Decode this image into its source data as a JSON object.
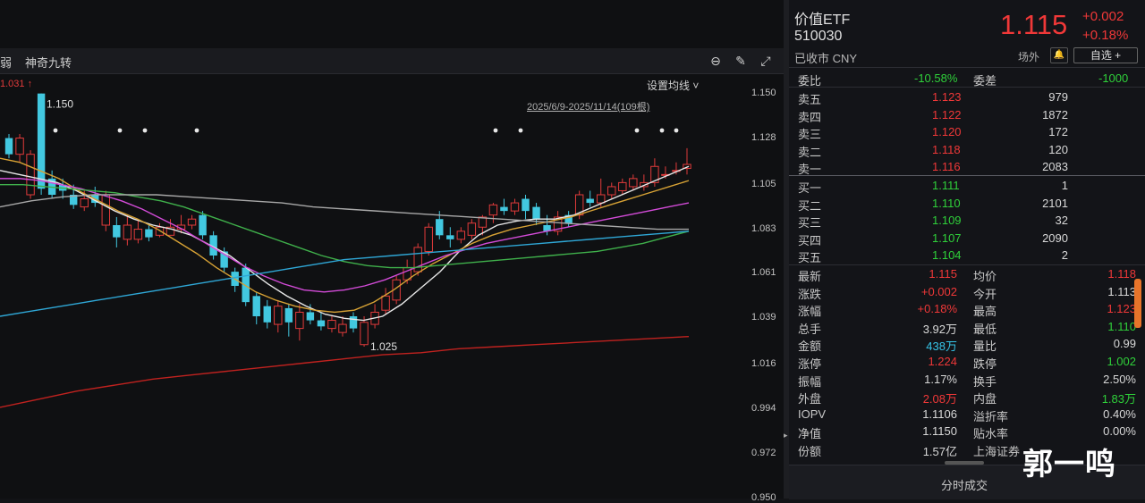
{
  "toolbar": {
    "left_fragment": "弱",
    "indicator": "神奇九转"
  },
  "chart": {
    "ma_note": "1.031 ↑",
    "set_ma_label": "设置均线 ˅",
    "range_label": "2025/6/9-2025/11/14(109根)",
    "high_label": "1.150",
    "low_label": "1.025",
    "yaxis": [
      "1.150",
      "1.128",
      "1.105",
      "1.083",
      "1.061",
      "1.039",
      "1.016",
      "0.994",
      "0.972",
      "0.950"
    ]
  },
  "chart_data": {
    "type": "candlestick",
    "ylim": [
      0.95,
      1.16
    ],
    "candles": [
      {
        "o": 1.128,
        "c": 1.12,
        "h": 1.13,
        "l": 1.118
      },
      {
        "o": 1.12,
        "c": 1.128,
        "h": 1.13,
        "l": 1.116
      },
      {
        "o": 1.1,
        "c": 1.12,
        "h": 1.122,
        "l": 1.098
      },
      {
        "o": 1.15,
        "c": 1.103,
        "h": 1.15,
        "l": 1.1
      },
      {
        "o": 1.108,
        "c": 1.1,
        "h": 1.112,
        "l": 1.098
      },
      {
        "o": 1.105,
        "c": 1.102,
        "h": 1.108,
        "l": 1.098
      },
      {
        "o": 1.1,
        "c": 1.095,
        "h": 1.105,
        "l": 1.093
      },
      {
        "o": 1.094,
        "c": 1.098,
        "h": 1.102,
        "l": 1.092
      },
      {
        "o": 1.1,
        "c": 1.096,
        "h": 1.104,
        "l": 1.094
      },
      {
        "o": 1.085,
        "c": 1.1,
        "h": 1.102,
        "l": 1.082
      },
      {
        "o": 1.085,
        "c": 1.079,
        "h": 1.089,
        "l": 1.074
      },
      {
        "o": 1.078,
        "c": 1.085,
        "h": 1.09,
        "l": 1.075
      },
      {
        "o": 1.078,
        "c": 1.083,
        "h": 1.088,
        "l": 1.076
      },
      {
        "o": 1.083,
        "c": 1.079,
        "h": 1.085,
        "l": 1.077
      },
      {
        "o": 1.08,
        "c": 1.084,
        "h": 1.086,
        "l": 1.079
      },
      {
        "o": 1.08,
        "c": 1.084,
        "h": 1.088,
        "l": 1.08
      },
      {
        "o": 1.083,
        "c": 1.085,
        "h": 1.09,
        "l": 1.081
      },
      {
        "o": 1.085,
        "c": 1.088,
        "h": 1.09,
        "l": 1.083
      },
      {
        "o": 1.09,
        "c": 1.08,
        "h": 1.092,
        "l": 1.078
      },
      {
        "o": 1.08,
        "c": 1.07,
        "h": 1.082,
        "l": 1.068
      },
      {
        "o": 1.072,
        "c": 1.064,
        "h": 1.074,
        "l": 1.062
      },
      {
        "o": 1.062,
        "c": 1.055,
        "h": 1.064,
        "l": 1.052
      },
      {
        "o": 1.064,
        "c": 1.047,
        "h": 1.066,
        "l": 1.045
      },
      {
        "o": 1.05,
        "c": 1.04,
        "h": 1.052,
        "l": 1.036
      },
      {
        "o": 1.045,
        "c": 1.037,
        "h": 1.048,
        "l": 1.034
      },
      {
        "o": 1.036,
        "c": 1.045,
        "h": 1.048,
        "l": 1.032
      },
      {
        "o": 1.044,
        "c": 1.037,
        "h": 1.046,
        "l": 1.03
      },
      {
        "o": 1.034,
        "c": 1.042,
        "h": 1.046,
        "l": 1.028
      },
      {
        "o": 1.042,
        "c": 1.038,
        "h": 1.046,
        "l": 1.036
      },
      {
        "o": 1.038,
        "c": 1.035,
        "h": 1.042,
        "l": 1.033
      },
      {
        "o": 1.034,
        "c": 1.038,
        "h": 1.04,
        "l": 1.032
      },
      {
        "o": 1.032,
        "c": 1.036,
        "h": 1.04,
        "l": 1.03
      },
      {
        "o": 1.04,
        "c": 1.034,
        "h": 1.042,
        "l": 1.032
      },
      {
        "o": 1.026,
        "c": 1.037,
        "h": 1.04,
        "l": 1.025
      },
      {
        "o": 1.036,
        "c": 1.042,
        "h": 1.046,
        "l": 1.034
      },
      {
        "o": 1.043,
        "c": 1.05,
        "h": 1.054,
        "l": 1.041
      },
      {
        "o": 1.048,
        "c": 1.058,
        "h": 1.06,
        "l": 1.046
      },
      {
        "o": 1.058,
        "c": 1.064,
        "h": 1.068,
        "l": 1.056
      },
      {
        "o": 1.062,
        "c": 1.074,
        "h": 1.076,
        "l": 1.06
      },
      {
        "o": 1.072,
        "c": 1.084,
        "h": 1.086,
        "l": 1.07
      },
      {
        "o": 1.088,
        "c": 1.08,
        "h": 1.092,
        "l": 1.078
      },
      {
        "o": 1.08,
        "c": 1.078,
        "h": 1.084,
        "l": 1.074
      },
      {
        "o": 1.078,
        "c": 1.082,
        "h": 1.084,
        "l": 1.076
      },
      {
        "o": 1.08,
        "c": 1.086,
        "h": 1.088,
        "l": 1.078
      },
      {
        "o": 1.084,
        "c": 1.089,
        "h": 1.09,
        "l": 1.08
      },
      {
        "o": 1.09,
        "c": 1.095,
        "h": 1.096,
        "l": 1.086
      },
      {
        "o": 1.094,
        "c": 1.092,
        "h": 1.098,
        "l": 1.09
      },
      {
        "o": 1.092,
        "c": 1.096,
        "h": 1.098,
        "l": 1.09
      },
      {
        "o": 1.098,
        "c": 1.092,
        "h": 1.1,
        "l": 1.088
      },
      {
        "o": 1.094,
        "c": 1.088,
        "h": 1.096,
        "l": 1.085
      },
      {
        "o": 1.085,
        "c": 1.082,
        "h": 1.09,
        "l": 1.08
      },
      {
        "o": 1.082,
        "c": 1.089,
        "h": 1.092,
        "l": 1.08
      },
      {
        "o": 1.09,
        "c": 1.086,
        "h": 1.092,
        "l": 1.084
      },
      {
        "o": 1.09,
        "c": 1.1,
        "h": 1.102,
        "l": 1.088
      },
      {
        "o": 1.098,
        "c": 1.096,
        "h": 1.102,
        "l": 1.094
      },
      {
        "o": 1.096,
        "c": 1.1,
        "h": 1.108,
        "l": 1.094
      },
      {
        "o": 1.1,
        "c": 1.104,
        "h": 1.106,
        "l": 1.098
      },
      {
        "o": 1.102,
        "c": 1.106,
        "h": 1.108,
        "l": 1.1
      },
      {
        "o": 1.104,
        "c": 1.108,
        "h": 1.11,
        "l": 1.102
      },
      {
        "o": 1.104,
        "c": 1.106,
        "h": 1.11,
        "l": 1.102
      },
      {
        "o": 1.106,
        "c": 1.114,
        "h": 1.118,
        "l": 1.104
      },
      {
        "o": 1.11,
        "c": 1.11,
        "h": 1.114,
        "l": 1.108
      },
      {
        "o": 1.112,
        "c": 1.112,
        "h": 1.116,
        "l": 1.11
      },
      {
        "o": 1.113,
        "c": 1.115,
        "h": 1.123,
        "l": 1.11
      }
    ],
    "ma_lines": [
      {
        "color": "#e8e8e8",
        "points": [
          1.112,
          1.11,
          1.108,
          1.106,
          1.102,
          1.097,
          1.092,
          1.088,
          1.085,
          1.083,
          1.08,
          1.075,
          1.07,
          1.063,
          1.056,
          1.05,
          1.045,
          1.041,
          1.039,
          1.038,
          1.04,
          1.046,
          1.054,
          1.062,
          1.072,
          1.08,
          1.085,
          1.087,
          1.088,
          1.088,
          1.09,
          1.094,
          1.098,
          1.102,
          1.106,
          1.11,
          1.114
        ]
      },
      {
        "color": "#d7a235",
        "points": [
          1.118,
          1.116,
          1.112,
          1.108,
          1.102,
          1.097,
          1.092,
          1.088,
          1.083,
          1.077,
          1.071,
          1.064,
          1.058,
          1.052,
          1.048,
          1.045,
          1.043,
          1.042,
          1.043,
          1.047,
          1.053,
          1.06,
          1.066,
          1.071,
          1.076,
          1.08,
          1.083,
          1.085,
          1.087,
          1.089,
          1.092,
          1.095,
          1.098,
          1.101,
          1.104,
          1.107
        ]
      },
      {
        "color": "#d34bd8",
        "points": [
          1.108,
          1.108,
          1.107,
          1.105,
          1.103,
          1.1,
          1.097,
          1.093,
          1.088,
          1.083,
          1.077,
          1.071,
          1.065,
          1.06,
          1.056,
          1.053,
          1.052,
          1.053,
          1.055,
          1.058,
          1.062,
          1.066,
          1.07,
          1.073,
          1.076,
          1.078,
          1.08,
          1.082,
          1.084,
          1.086,
          1.088,
          1.09,
          1.092,
          1.094,
          1.096
        ]
      },
      {
        "color": "#3fb04b",
        "points": [
          1.105,
          1.105,
          1.104,
          1.103,
          1.102,
          1.101,
          1.099,
          1.097,
          1.094,
          1.09,
          1.086,
          1.082,
          1.078,
          1.074,
          1.07,
          1.067,
          1.065,
          1.064,
          1.064,
          1.065,
          1.066,
          1.067,
          1.068,
          1.069,
          1.07,
          1.071,
          1.072,
          1.074,
          1.076,
          1.079,
          1.082
        ]
      },
      {
        "color": "#2fa7d6",
        "points": [
          1.04,
          1.042,
          1.044,
          1.046,
          1.048,
          1.05,
          1.052,
          1.054,
          1.056,
          1.058,
          1.06,
          1.062,
          1.064,
          1.066,
          1.068,
          1.069,
          1.07,
          1.071,
          1.072,
          1.073,
          1.074,
          1.075,
          1.076,
          1.077,
          1.078,
          1.079,
          1.08,
          1.081,
          1.082
        ]
      },
      {
        "color": "#a8a8a8",
        "points": [
          1.094,
          1.097,
          1.099,
          1.1,
          1.1,
          1.1,
          1.099,
          1.098,
          1.097,
          1.096,
          1.094,
          1.093,
          1.092,
          1.091,
          1.09,
          1.089,
          1.088,
          1.087,
          1.086,
          1.085,
          1.084,
          1.083,
          1.083
        ]
      },
      {
        "color": "#c0221f",
        "points": [
          0.995,
          0.999,
          1.003,
          1.006,
          1.009,
          1.011,
          1.013,
          1.015,
          1.017,
          1.019,
          1.021,
          1.022,
          1.024,
          1.025,
          1.026,
          1.027,
          1.028,
          1.029,
          1.03
        ]
      }
    ]
  },
  "quote": {
    "name": "价值ETF",
    "code": "510030",
    "status": "已收市 CNY",
    "price": "1.115",
    "change": "+0.002",
    "change_pct": "+0.18%",
    "venue": "场外",
    "bell": "🔔",
    "watch_label": "自选 +"
  },
  "book": {
    "wb_label": "委比",
    "wb_value": "-10.58%",
    "wc_label": "委差",
    "wc_value": "-1000",
    "asks": [
      {
        "label": "卖五",
        "price": "1.123",
        "vol": "979"
      },
      {
        "label": "卖四",
        "price": "1.122",
        "vol": "1872"
      },
      {
        "label": "卖三",
        "price": "1.120",
        "vol": "172"
      },
      {
        "label": "卖二",
        "price": "1.118",
        "vol": "120"
      },
      {
        "label": "卖一",
        "price": "1.116",
        "vol": "2083"
      }
    ],
    "bids": [
      {
        "label": "买一",
        "price": "1.111",
        "vol": "1"
      },
      {
        "label": "买二",
        "price": "1.110",
        "vol": "2101"
      },
      {
        "label": "买三",
        "price": "1.109",
        "vol": "32"
      },
      {
        "label": "买四",
        "price": "1.107",
        "vol": "2090"
      },
      {
        "label": "买五",
        "price": "1.104",
        "vol": "2"
      }
    ]
  },
  "stats": [
    {
      "l1": "最新",
      "v1": "1.115",
      "c1": "red",
      "l2": "均价",
      "v2": "1.118",
      "c2": "red"
    },
    {
      "l1": "涨跌",
      "v1": "+0.002",
      "c1": "red",
      "l2": "今开",
      "v2": "1.113",
      "c2": "white"
    },
    {
      "l1": "涨幅",
      "v1": "+0.18%",
      "c1": "red",
      "l2": "最高",
      "v2": "1.123",
      "c2": "red"
    },
    {
      "l1": "总手",
      "v1": "3.92万",
      "c1": "white",
      "l2": "最低",
      "v2": "1.110",
      "c2": "green"
    },
    {
      "l1": "金额",
      "v1": "438万",
      "c1": "cyan",
      "l2": "量比",
      "v2": "0.99",
      "c2": "white"
    },
    {
      "l1": "涨停",
      "v1": "1.224",
      "c1": "red",
      "l2": "跌停",
      "v2": "1.002",
      "c2": "green"
    },
    {
      "l1": "振幅",
      "v1": "1.17%",
      "c1": "white",
      "l2": "换手",
      "v2": "2.50%",
      "c2": "white"
    },
    {
      "l1": "外盘",
      "v1": "2.08万",
      "c1": "red",
      "l2": "内盘",
      "v2": "1.83万",
      "c2": "green"
    },
    {
      "l1": "IOPV",
      "v1": "1.1106",
      "c1": "white",
      "l2": "溢折率",
      "v2": "0.40%",
      "c2": "white"
    },
    {
      "l1": "净值",
      "v1": "1.1150",
      "c1": "white",
      "l2": "贴水率",
      "v2": "0.00%",
      "c2": "white"
    },
    {
      "l1": "份额",
      "v1": "1.57亿",
      "c1": "white",
      "l2": "上海证券",
      "v2": "",
      "c2": "white"
    }
  ],
  "bottom_tab": "分时成交",
  "watermark": "郭一鸣"
}
